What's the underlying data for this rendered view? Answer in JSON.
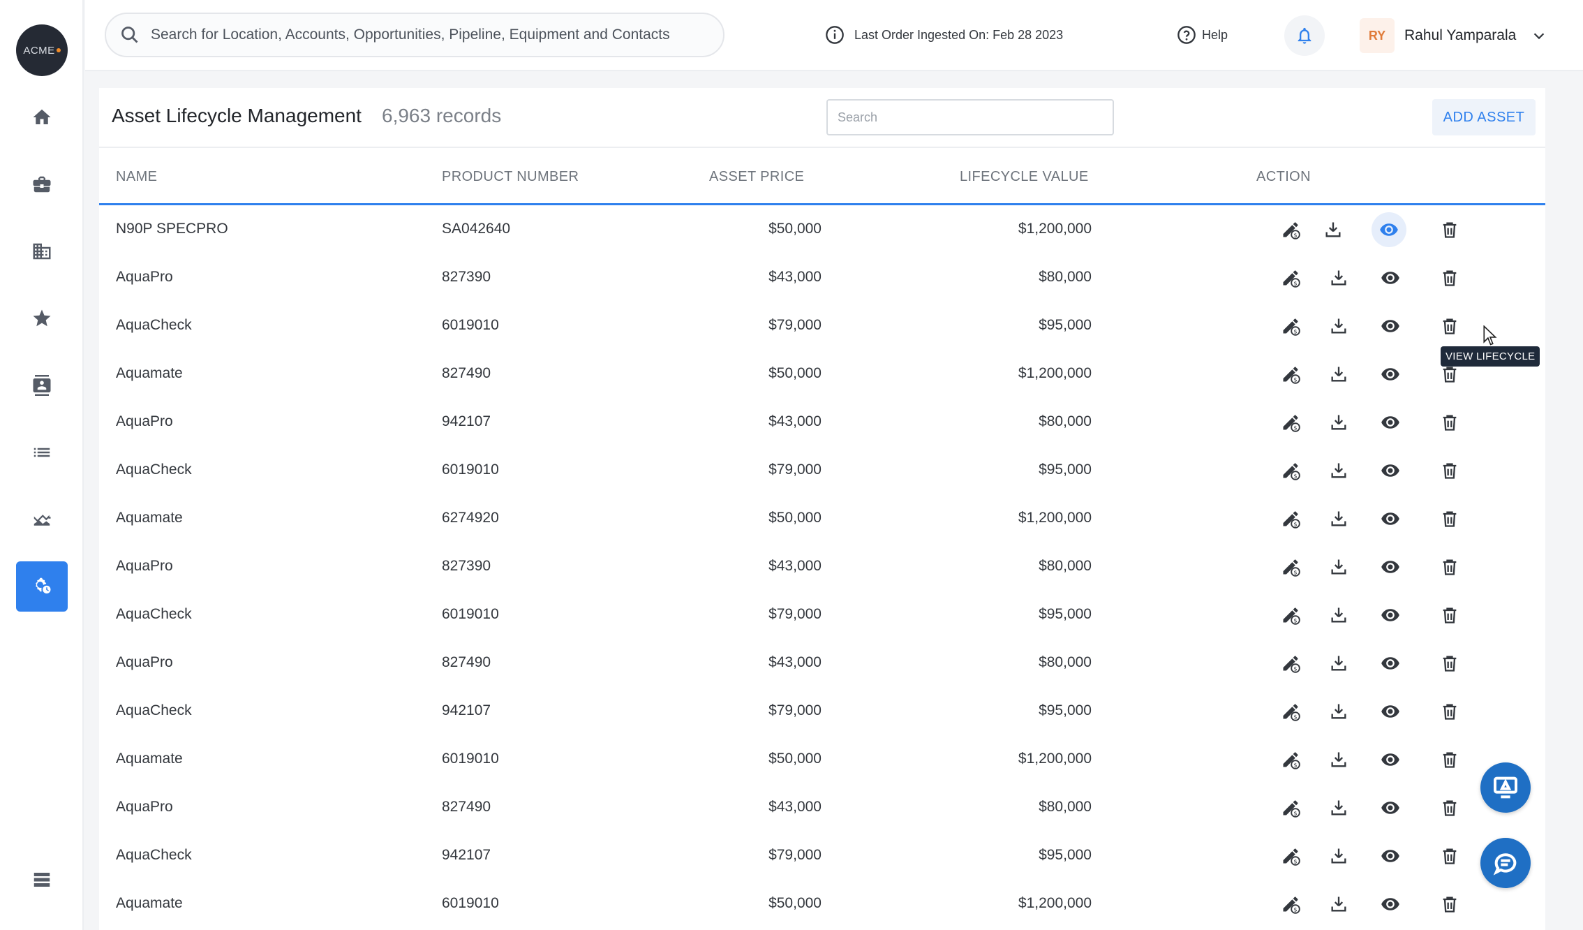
{
  "app": {
    "logo_text": "ACME"
  },
  "sidebar": {
    "items": [
      {
        "name": "home",
        "icon": "home-icon"
      },
      {
        "name": "accounts",
        "icon": "briefcase-icon"
      },
      {
        "name": "locations",
        "icon": "building-icon"
      },
      {
        "name": "favorites",
        "icon": "star-icon"
      },
      {
        "name": "contacts",
        "icon": "contact-card-icon"
      },
      {
        "name": "lists",
        "icon": "list-icon"
      },
      {
        "name": "analytics",
        "icon": "chart-icon"
      },
      {
        "name": "asset-lifecycle",
        "icon": "gear-clock-icon",
        "active": true
      }
    ],
    "bottom_icon": "stack-icon"
  },
  "header": {
    "search_placeholder": "Search for Location, Accounts, Opportunities, Pipeline, Equipment and Contacts",
    "ingest_text": "Last Order Ingested On: Feb 28 2023",
    "help_label": "Help",
    "user_initials": "RY",
    "user_name": "Rahul Yamparala"
  },
  "main": {
    "title": "Asset Lifecycle Management",
    "record_count": "6,963 records",
    "search_placeholder": "Search",
    "add_button": "ADD ASSET",
    "columns": {
      "name": "NAME",
      "product": "PRODUCT NUMBER",
      "price": "ASSET PRICE",
      "lifecycle": "LIFECYCLE VALUE",
      "action": "ACTION"
    },
    "tooltip": "VIEW LIFECYCLE",
    "rows": [
      {
        "name": "N90P SPECPRO",
        "product": "SA042640",
        "price": "$50,000",
        "lifecycle": "$1,200,000"
      },
      {
        "name": "AquaPro",
        "product": "827390",
        "price": "$43,000",
        "lifecycle": "$80,000"
      },
      {
        "name": "AquaCheck",
        "product": "6019010",
        "price": "$79,000",
        "lifecycle": "$95,000"
      },
      {
        "name": "Aquamate",
        "product": "827490",
        "price": "$50,000",
        "lifecycle": "$1,200,000"
      },
      {
        "name": "AquaPro",
        "product": "942107",
        "price": "$43,000",
        "lifecycle": "$80,000"
      },
      {
        "name": "AquaCheck",
        "product": "6019010",
        "price": "$79,000",
        "lifecycle": "$95,000"
      },
      {
        "name": "Aquamate",
        "product": "6274920",
        "price": "$50,000",
        "lifecycle": "$1,200,000"
      },
      {
        "name": "AquaPro",
        "product": "827390",
        "price": "$43,000",
        "lifecycle": "$80,000"
      },
      {
        "name": "AquaCheck",
        "product": "6019010",
        "price": "$79,000",
        "lifecycle": "$95,000"
      },
      {
        "name": "AquaPro",
        "product": "827490",
        "price": "$43,000",
        "lifecycle": "$80,000"
      },
      {
        "name": "AquaCheck",
        "product": "942107",
        "price": "$79,000",
        "lifecycle": "$95,000"
      },
      {
        "name": "Aquamate",
        "product": "6019010",
        "price": "$50,000",
        "lifecycle": "$1,200,000"
      },
      {
        "name": "AquaPro",
        "product": "827490",
        "price": "$43,000",
        "lifecycle": "$80,000"
      },
      {
        "name": "AquaCheck",
        "product": "942107",
        "price": "$79,000",
        "lifecycle": "$95,000"
      },
      {
        "name": "Aquamate",
        "product": "6019010",
        "price": "$50,000",
        "lifecycle": "$1,200,000"
      }
    ]
  },
  "colors": {
    "accent": "#2f80ed",
    "fab": "#1f6fc4",
    "avatar_text": "#e07b39"
  },
  "floating": [
    "screen-share-icon",
    "chat-icon"
  ]
}
